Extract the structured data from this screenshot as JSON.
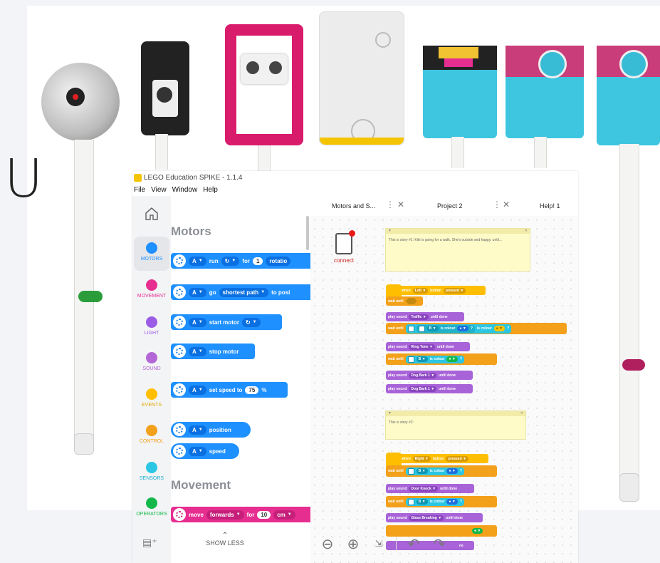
{
  "window": {
    "title": "LEGO Education SPIKE - 1.1.4"
  },
  "menu": [
    "File",
    "View",
    "Window",
    "Help"
  ],
  "background_char": "U",
  "colors": {
    "motors": "#1e90ff",
    "movement": "#e62e91",
    "light": "#9b5de5",
    "sound": "#b366d6",
    "events": "#ffbf00",
    "control": "#f3a01a",
    "sensors": "#2ac6e3",
    "operators": "#14b84a"
  },
  "categories": [
    {
      "label": "MOTORS",
      "color": "#1e90ff"
    },
    {
      "label": "MOVEMENT",
      "color": "#e62e91"
    },
    {
      "label": "LIGHT",
      "color": "#9b5de5"
    },
    {
      "label": "SOUND",
      "color": "#b366d6"
    },
    {
      "label": "EVENTS",
      "color": "#ffbf00"
    },
    {
      "label": "CONTROL",
      "color": "#f3a01a"
    },
    {
      "label": "SENSORS",
      "color": "#2ac6e3"
    },
    {
      "label": "OPERATORS",
      "color": "#14b84a"
    }
  ],
  "palette": {
    "motors_title": "Motors",
    "movement_title": "Movement",
    "port": "A",
    "blocks": {
      "run": {
        "word": "run",
        "for": "for",
        "num": "1",
        "unit": "rotatio"
      },
      "go": {
        "word": "go",
        "opt": "shortest path",
        "to": "to posi"
      },
      "start": {
        "text": "start motor"
      },
      "stop": {
        "text": "stop motor"
      },
      "speed": {
        "text": "set speed to",
        "num": "75",
        "unit": "%"
      },
      "position": {
        "text": "position"
      },
      "speed_reporter": {
        "text": "speed"
      },
      "move": {
        "word": "move",
        "opt": "forwards",
        "for": "for",
        "num": "10",
        "unit": "cm"
      }
    },
    "show_less": "SHOW LESS"
  },
  "tabs": [
    {
      "label": "Motors and S..."
    },
    {
      "label": "Project 2"
    },
    {
      "label": "Help! 1"
    }
  ],
  "connect": {
    "label": "connect"
  },
  "notes": [
    {
      "text": "This is story #1: Kiki is going for a walk. She's outside and happy, until..."
    },
    {
      "text": "This is story #2:"
    }
  ],
  "script1": {
    "when": "when",
    "button": "Left",
    "button_word": "button",
    "event": "pressed",
    "wait": "wait until",
    "play1": "play sound",
    "sound1": "Traffic",
    "until_done": "until done",
    "port_b": "B",
    "is_colour": "is colour",
    "q": "?",
    "sound2": "Ring Tone",
    "sound3": "Dog Bark 1",
    "sound4": "Dog Bark 1"
  },
  "script2": {
    "button": "Right",
    "sound1": "Door Knock",
    "sound2": "Glass Breaking",
    "partial": "ne"
  }
}
